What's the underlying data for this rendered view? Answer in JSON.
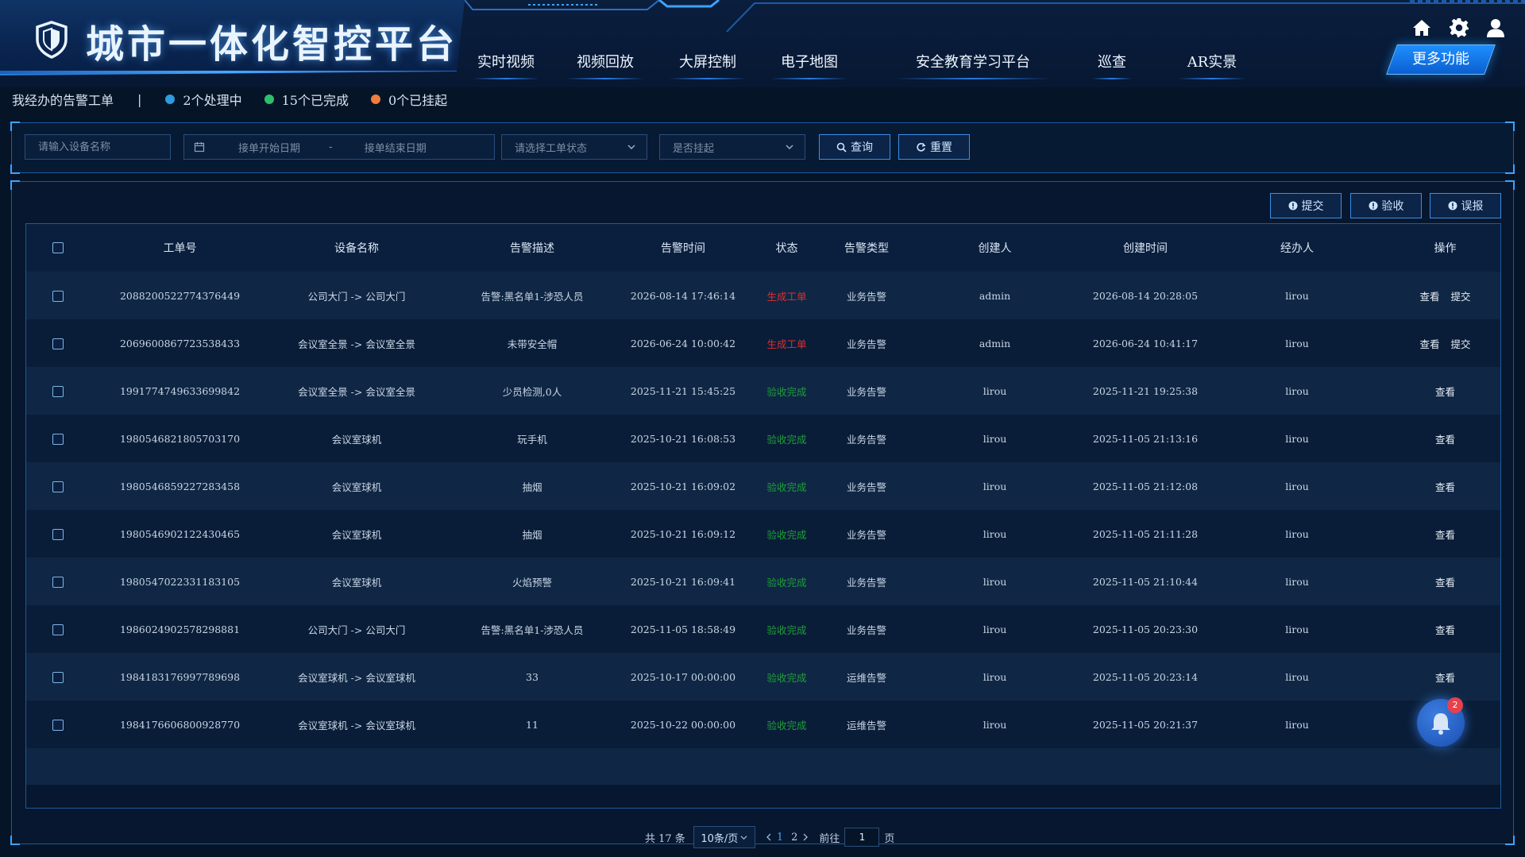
{
  "app": {
    "title": "城市一体化智控平台"
  },
  "nav": {
    "items": [
      "实时视频",
      "视频回放",
      "大屏控制",
      "电子地图",
      "安全教育学习平台",
      "巡查",
      "AR实景"
    ],
    "more_label": "更多功能"
  },
  "summary": {
    "title": "我经办的告警工单",
    "stats": [
      {
        "label": "2个处理中",
        "color": "#2e9bdc"
      },
      {
        "label": "15个已完成",
        "color": "#2fbf6a"
      },
      {
        "label": "0个已挂起",
        "color": "#f07d3b"
      }
    ]
  },
  "filters": {
    "device_placeholder": "请输入设备名称",
    "start_date_placeholder": "接单开始日期",
    "date_separator": "-",
    "end_date_placeholder": "接单结束日期",
    "status_placeholder": "请选择工单状态",
    "suspend_placeholder": "是否挂起",
    "query_label": "查询",
    "reset_label": "重置"
  },
  "actions": {
    "submit": "提交",
    "accept": "验收",
    "false_report": "误报"
  },
  "table": {
    "columns": [
      "工单号",
      "设备名称",
      "告警描述",
      "告警时间",
      "状态",
      "告警类型",
      "创建人",
      "创建时间",
      "经办人",
      "操作"
    ],
    "rows": [
      {
        "id": "2088200522774376449",
        "device": "公司大门 -> 公司大门",
        "desc": "告警:黑名单1-涉恐人员",
        "alarm_time": "2026-08-14 17:46:14",
        "status": "生成工单",
        "status_color": "red",
        "type": "业务告警",
        "creator": "admin",
        "created": "2026-08-14 20:28:05",
        "handler": "lirou",
        "ops": [
          "查看",
          "提交"
        ]
      },
      {
        "id": "2069600867723538433",
        "device": "会议室全景 -> 会议室全景",
        "desc": "未带安全帽",
        "alarm_time": "2026-06-24 10:00:42",
        "status": "生成工单",
        "status_color": "red",
        "type": "业务告警",
        "creator": "admin",
        "created": "2026-06-24 10:41:17",
        "handler": "lirou",
        "ops": [
          "查看",
          "提交"
        ]
      },
      {
        "id": "1991774749633699842",
        "device": "会议室全景 -> 会议室全景",
        "desc": "少员检测,0人",
        "alarm_time": "2025-11-21 15:45:25",
        "status": "验收完成",
        "status_color": "green",
        "type": "业务告警",
        "creator": "lirou",
        "created": "2025-11-21 19:25:38",
        "handler": "lirou",
        "ops": [
          "查看"
        ]
      },
      {
        "id": "1980546821805703170",
        "device": "会议室球机",
        "desc": "玩手机",
        "alarm_time": "2025-10-21 16:08:53",
        "status": "验收完成",
        "status_color": "green",
        "type": "业务告警",
        "creator": "lirou",
        "created": "2025-11-05 21:13:16",
        "handler": "lirou",
        "ops": [
          "查看"
        ]
      },
      {
        "id": "1980546859227283458",
        "device": "会议室球机",
        "desc": "抽烟",
        "alarm_time": "2025-10-21 16:09:02",
        "status": "验收完成",
        "status_color": "green",
        "type": "业务告警",
        "creator": "lirou",
        "created": "2025-11-05 21:12:08",
        "handler": "lirou",
        "ops": [
          "查看"
        ]
      },
      {
        "id": "1980546902122430465",
        "device": "会议室球机",
        "desc": "抽烟",
        "alarm_time": "2025-10-21 16:09:12",
        "status": "验收完成",
        "status_color": "green",
        "type": "业务告警",
        "creator": "lirou",
        "created": "2025-11-05 21:11:28",
        "handler": "lirou",
        "ops": [
          "查看"
        ]
      },
      {
        "id": "1980547022331183105",
        "device": "会议室球机",
        "desc": "火焰预警",
        "alarm_time": "2025-10-21 16:09:41",
        "status": "验收完成",
        "status_color": "green",
        "type": "业务告警",
        "creator": "lirou",
        "created": "2025-11-05 21:10:44",
        "handler": "lirou",
        "ops": [
          "查看"
        ]
      },
      {
        "id": "1986024902578298881",
        "device": "公司大门 -> 公司大门",
        "desc": "告警:黑名单1-涉恐人员",
        "alarm_time": "2025-11-05 18:58:49",
        "status": "验收完成",
        "status_color": "green",
        "type": "业务告警",
        "creator": "lirou",
        "created": "2025-11-05 20:23:30",
        "handler": "lirou",
        "ops": [
          "查看"
        ]
      },
      {
        "id": "1984183176997789698",
        "device": "会议室球机 -> 会议室球机",
        "desc": "33",
        "alarm_time": "2025-10-17 00:00:00",
        "status": "验收完成",
        "status_color": "green",
        "type": "运维告警",
        "creator": "lirou",
        "created": "2025-11-05 20:23:14",
        "handler": "lirou",
        "ops": [
          "查看"
        ]
      },
      {
        "id": "1984176606800928770",
        "device": "会议室球机 -> 会议室球机",
        "desc": "11",
        "alarm_time": "2025-10-22 00:00:00",
        "status": "验收完成",
        "status_color": "green",
        "type": "运维告警",
        "creator": "lirou",
        "created": "2025-11-05 20:21:37",
        "handler": "lirou",
        "ops": []
      }
    ]
  },
  "pagination": {
    "total_label": "共 17 条",
    "page_size_label": "10条/页",
    "pages": [
      "1",
      "2"
    ],
    "current_page": "1",
    "goto_label": "前往",
    "goto_value": "1",
    "page_suffix": "页"
  },
  "notifications": {
    "badge": "2"
  },
  "colors": {
    "accent": "#3fa2ff",
    "background": "#061428",
    "status_red": "#e52d2d",
    "status_green": "#1f9e3a"
  },
  "icons": [
    "shield-icon",
    "home-icon",
    "gear-icon",
    "user-icon",
    "calendar-icon",
    "chevron-down-icon",
    "search-icon",
    "refresh-icon",
    "info-icon",
    "bell-icon"
  ]
}
